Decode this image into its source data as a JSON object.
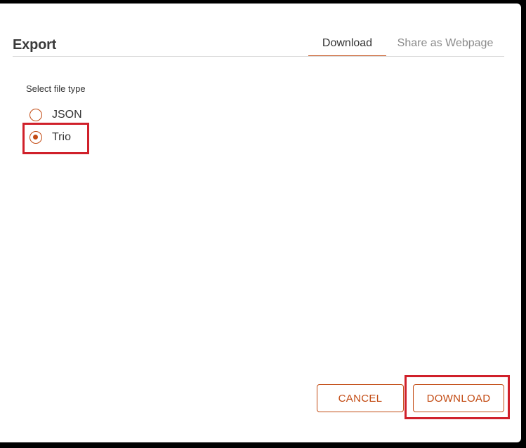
{
  "dialog": {
    "title": "Export",
    "tabs": [
      {
        "label": "Download",
        "active": true
      },
      {
        "label": "Share as Webpage",
        "active": false
      }
    ],
    "file_type_label": "Select file type",
    "options": [
      {
        "label": "JSON",
        "selected": false
      },
      {
        "label": "Trio",
        "selected": true
      }
    ],
    "cancel_label": "CANCEL",
    "download_label": "DOWNLOAD"
  },
  "colors": {
    "accent": "#c24a12",
    "highlight": "#d0202a"
  }
}
